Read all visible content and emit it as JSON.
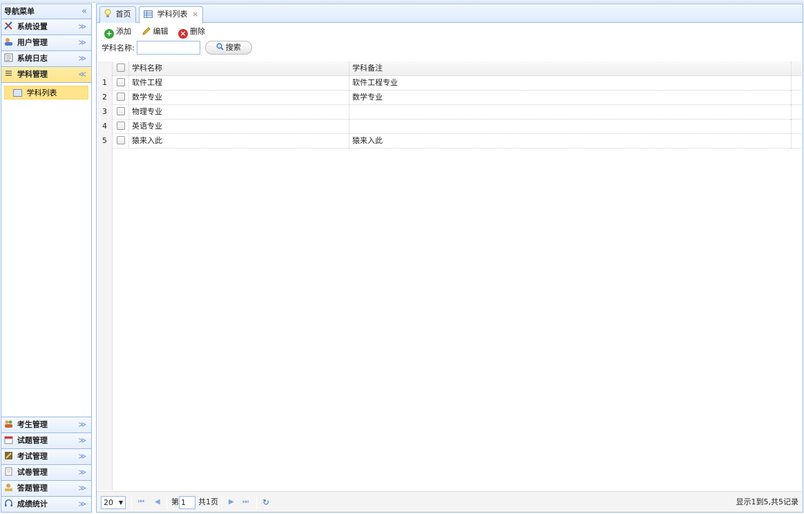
{
  "sidebar": {
    "title": "导航菜单",
    "collapse_glyph": "«",
    "items_top": [
      {
        "label": "系统设置",
        "icon": "tools-icon"
      },
      {
        "label": "用户管理",
        "icon": "users-icon"
      },
      {
        "label": "系统日志",
        "icon": "log-icon"
      },
      {
        "label": "学科管理",
        "icon": "list-icon"
      }
    ],
    "active_sub": "学科列表",
    "items_bottom": [
      {
        "label": "考生管理",
        "icon": "students-icon"
      },
      {
        "label": "试题管理",
        "icon": "calendar-icon"
      },
      {
        "label": "考试管理",
        "icon": "exam-icon"
      },
      {
        "label": "试卷管理",
        "icon": "paper-icon"
      },
      {
        "label": "答题管理",
        "icon": "answer-icon"
      },
      {
        "label": "成绩统计",
        "icon": "headset-icon"
      }
    ]
  },
  "tabs": [
    {
      "label": "首页",
      "icon": "bulb-icon"
    },
    {
      "label": "学科列表",
      "icon": "table-icon",
      "close": "×"
    }
  ],
  "toolbar": {
    "add": "添加",
    "edit": "编辑",
    "delete": "删除"
  },
  "search": {
    "label": "学科名称:",
    "button": "搜索",
    "value": ""
  },
  "grid": {
    "headers": {
      "name": "学科名称",
      "note": "学科备注"
    },
    "rows": [
      {
        "num": "1",
        "name": "软件工程",
        "note": "软件工程专业"
      },
      {
        "num": "2",
        "name": "数学专业",
        "note": "数学专业"
      },
      {
        "num": "3",
        "name": "物理专业",
        "note": ""
      },
      {
        "num": "4",
        "name": "英语专业",
        "note": ""
      },
      {
        "num": "5",
        "name": "猿来入此",
        "note": "猿来入此"
      }
    ]
  },
  "pager": {
    "page_size": "20",
    "page_prefix": "第",
    "page_value": "1",
    "page_total": "共1页",
    "summary": "显示1到5,共5记录"
  },
  "colors": {
    "border": "#95b8e7",
    "active": "#ffe48d",
    "header_bg": "#e0ecff"
  }
}
